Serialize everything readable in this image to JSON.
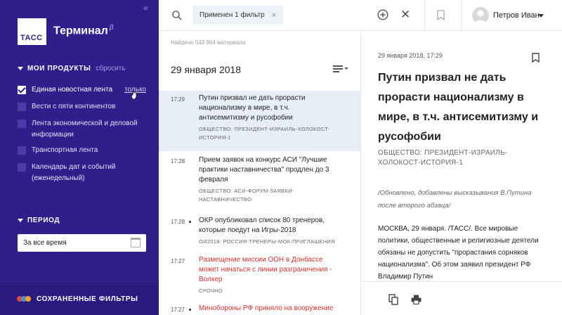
{
  "sidebar": {
    "collapse_glyph": "«",
    "logo_text": "ТАСС",
    "app_name": "Терминал",
    "beta_mark": "β",
    "products_heading": "МОИ ПРОДУКТЫ",
    "products_reset": "сбросить",
    "products": [
      {
        "label": "Единая новостная лента",
        "checked": true
      },
      {
        "label": "Вести с пяти континентов",
        "checked": false
      },
      {
        "label": "Лента экономической и деловой информации",
        "checked": false
      },
      {
        "label": "Транспортная лента",
        "checked": false
      },
      {
        "label": "Календарь дат и событий (еженедельный)",
        "checked": false
      }
    ],
    "only_link": "только",
    "period_heading": "ПЕРИОД",
    "period_value": "За все время",
    "saved_filters": "СОХРАНЕННЫЕ ФИЛЬТРЫ",
    "dot_colors": [
      "#e8453c",
      "#4a90e2",
      "#f5a623"
    ]
  },
  "topbar": {
    "filter_chip": "Применен 1 фильтр",
    "chip_close": "×",
    "clear_glyph": "✕",
    "user_name": "Петров Иван"
  },
  "list": {
    "found_text": "Найдено 543 964 материала",
    "date_heading": "29 января 2018",
    "items": [
      {
        "time": "17:29",
        "title": "Путин призвал не дать прорасти национализму в мире, в т.ч. антисемитизму и русофобии",
        "tags": "ОБЩЕСТВО: ПРЕЗИДЕНТ-ИЗРАИЛЬ-ХОЛОКОСТ-ИСТОРИЯ-1",
        "selected": true,
        "bullet": false,
        "red": false
      },
      {
        "time": "17:28",
        "title": "Прием заявок на конкурс АСИ \"Лучшие практики наставничества\" продлен до 3 февраля",
        "tags": "ОБЩЕСТВО: АСИ-ФОРУМ-ЗАЯВКИ-НАСТАВНИЧЕСТВО",
        "selected": false,
        "bullet": false,
        "red": false
      },
      {
        "time": "17:28",
        "title": "ОКР опубликовал список 80 тренеров, которые поедут на Игры-2018",
        "tags": "ОИ2018: РОССИЯ-ТРЕНЕРЫ-МОК-ПРИГЛАШЕНИЯ",
        "selected": false,
        "bullet": true,
        "red": false
      },
      {
        "time": "17:27",
        "title": "Размещение миссии ООН в Донбассе может начаться с линии разграничения - Волкер",
        "tags": "СРОЧНО",
        "selected": false,
        "bullet": false,
        "red": true
      },
      {
        "time": "17:27",
        "title": "Минобороны РФ приняло на вооружение",
        "tags": "",
        "selected": false,
        "bullet": true,
        "red": true
      }
    ]
  },
  "article": {
    "datetime": "29 января 2018, 17:29",
    "title": "Путин призвал не дать прорасти национализму в мире, в т.ч. антисемитизму и русофобии",
    "tags": "ОБЩЕСТВО: ПРЕЗИДЕНТ-ИЗРАИЛЬ-ХОЛОКОСТ-ИСТОРИЯ-1",
    "update_note": "/Обновлено, добавлены высказывания В.Путина после второго абзаца/",
    "body": "МОСКВА, 29 января. /ТАСС/. Все мировые политики, общественные и религиозные деятели обязаны не допустить \"прорастания сорняков национализма\". Об этом заявил президент РФ Владимир Путин"
  }
}
